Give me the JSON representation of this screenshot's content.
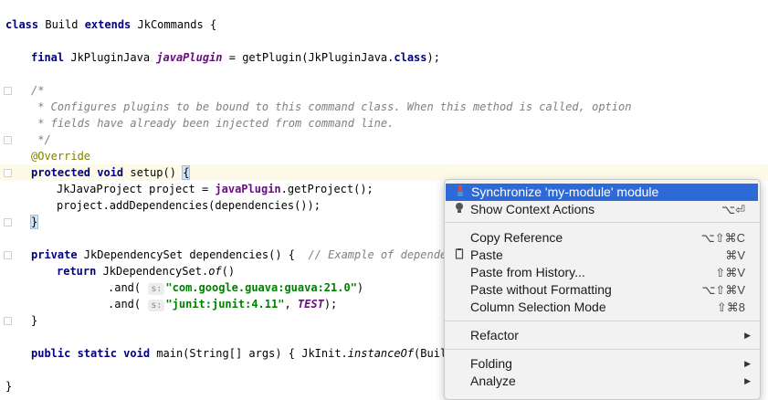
{
  "code": {
    "class_decl": {
      "kw1": "class",
      "name": " Build ",
      "kw2": "extends",
      "rest": " JkCommands {"
    },
    "field": {
      "kw": "final",
      "type": " JkPluginJava ",
      "name": "javaPlugin",
      "rest": " = getPlugin(JkPluginJava.",
      "cls": "class",
      "end": ");"
    },
    "comment": [
      "/*",
      " * Configures plugins to be bound to this command class. When this method is called, option",
      " * fields have already been injected from command line.",
      " */"
    ],
    "annotation": "@Override",
    "setup": {
      "kw": "protected void",
      "rest": " setup() ",
      "brace": "{"
    },
    "setup_body1": {
      "a": "JkJavaProject project = ",
      "field": "javaPlugin",
      "b": ".getProject();"
    },
    "setup_body2": "project.addDependencies(dependencies());",
    "close_brace": "}",
    "deps_decl": {
      "kw": "private",
      "rest": " JkDependencySet dependencies() {  ",
      "cmt": "// Example of dependen"
    },
    "deps_ret": {
      "kw": "return",
      "a": " JkDependencySet.",
      "it": "of",
      "b": "()"
    },
    "deps_and1": {
      "a": ".and( ",
      "hint": "s:",
      "str": "\"com.google.guava:guava:21.0\"",
      "b": ")"
    },
    "deps_and2": {
      "a": ".and( ",
      "hint": "s:",
      "str": "\"junit:junit:4.11\"",
      "b": ", ",
      "it": "TEST",
      "c": ");"
    },
    "deps_close": "}",
    "main_decl": {
      "kw": "public static void",
      "a": " main(String[] args) { JkInit.",
      "it": "instanceOf",
      "b": "(Build."
    },
    "class_close": "}"
  },
  "context_menu": {
    "items": [
      {
        "label": "Synchronize 'my-module' module",
        "shortcut": "",
        "icon": "sync-icon",
        "selected": true
      },
      {
        "label": "Show Context Actions",
        "shortcut": "⌥⏎",
        "icon": "lightbulb-icon"
      },
      {
        "label": "Copy Reference",
        "shortcut": "⌥⇧⌘C"
      },
      {
        "label": "Paste",
        "shortcut": "⌘V",
        "icon": "clipboard-icon"
      },
      {
        "label": "Paste from History...",
        "shortcut": "⇧⌘V"
      },
      {
        "label": "Paste without Formatting",
        "shortcut": "⌥⇧⌘V"
      },
      {
        "label": "Column Selection Mode",
        "shortcut": "⇧⌘8"
      },
      {
        "label": "Refactor",
        "submenu": true
      },
      {
        "label": "Folding",
        "submenu": true
      },
      {
        "label": "Analyze",
        "submenu": true
      }
    ]
  }
}
